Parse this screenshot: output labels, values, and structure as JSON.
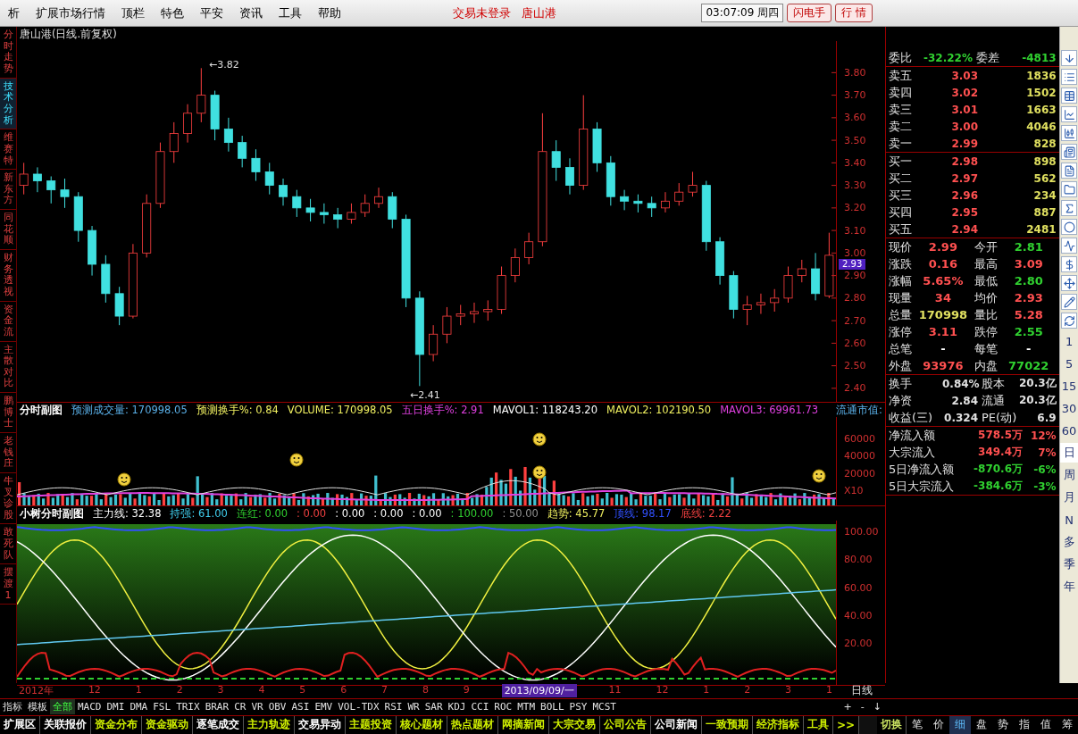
{
  "menu_bar": {
    "items": [
      "析",
      "扩展市场行情",
      "顶栏",
      "特色",
      "平安",
      "资讯",
      "工具",
      "帮助"
    ],
    "status": [
      "交易未登录",
      "唐山港"
    ],
    "clock": "03:07:09 周四",
    "buttons": [
      "闪电手",
      "行 情"
    ]
  },
  "side_tabs": [
    {
      "label": "分时走势",
      "selected": false
    },
    {
      "label": "技术分析",
      "selected": true
    },
    {
      "label": "维赛特",
      "selected": false
    },
    {
      "label": "新东方",
      "selected": false
    },
    {
      "label": "同花顺",
      "selected": false
    },
    {
      "label": "财务透视",
      "selected": false
    },
    {
      "label": "资金流",
      "selected": false
    },
    {
      "label": "主散对比",
      "selected": false
    },
    {
      "label": "鹏博士",
      "selected": false
    },
    {
      "label": "老钱庄",
      "selected": false
    },
    {
      "label": "牛叉诊股",
      "selected": false
    },
    {
      "label": "敢死队",
      "selected": false
    },
    {
      "label": "摆渡1",
      "selected": false
    }
  ],
  "price_chart": {
    "title": "唐山港(日线.前复权)",
    "high_label": "←3.82",
    "low_label": "←2.41",
    "last_price_tag": "2.93",
    "chart_data": {
      "type": "candlestick",
      "ylim": [
        2.34,
        3.94
      ],
      "yticks": [
        {
          "value": 3.8,
          "label": "3.80"
        },
        {
          "value": 3.7,
          "label": "3.70"
        },
        {
          "value": 3.6,
          "label": "3.60"
        },
        {
          "value": 3.5,
          "label": "3.50"
        },
        {
          "value": 3.4,
          "label": "3.40"
        },
        {
          "value": 3.3,
          "label": "3.30"
        },
        {
          "value": 3.2,
          "label": "3.20"
        },
        {
          "value": 3.1,
          "label": "3.10"
        },
        {
          "value": 3.0,
          "label": "3.00"
        },
        {
          "value": 2.9,
          "label": "2.90"
        },
        {
          "value": 2.8,
          "label": "2.80"
        },
        {
          "value": 2.7,
          "label": "2.70"
        },
        {
          "value": 2.6,
          "label": "2.60"
        },
        {
          "value": 2.5,
          "label": "2.50"
        },
        {
          "value": 2.4,
          "label": "2.40"
        }
      ],
      "ohlc": [
        [
          3.3,
          3.4,
          3.26,
          3.35
        ],
        [
          3.35,
          3.38,
          3.27,
          3.32
        ],
        [
          3.32,
          3.34,
          3.22,
          3.28
        ],
        [
          3.28,
          3.33,
          3.2,
          3.25
        ],
        [
          3.25,
          3.27,
          3.05,
          3.1
        ],
        [
          3.1,
          3.12,
          2.9,
          2.95
        ],
        [
          2.95,
          2.99,
          2.78,
          2.82
        ],
        [
          2.82,
          2.85,
          2.68,
          2.72
        ],
        [
          2.72,
          3.04,
          2.71,
          3.0
        ],
        [
          3.0,
          3.26,
          2.98,
          3.22
        ],
        [
          3.22,
          3.49,
          3.2,
          3.45
        ],
        [
          3.45,
          3.58,
          3.4,
          3.53
        ],
        [
          3.53,
          3.66,
          3.49,
          3.62
        ],
        [
          3.62,
          3.82,
          3.58,
          3.7
        ],
        [
          3.7,
          3.72,
          3.5,
          3.55
        ],
        [
          3.55,
          3.6,
          3.45,
          3.49
        ],
        [
          3.49,
          3.52,
          3.38,
          3.42
        ],
        [
          3.42,
          3.46,
          3.32,
          3.36
        ],
        [
          3.36,
          3.4,
          3.26,
          3.3
        ],
        [
          3.3,
          3.33,
          3.21,
          3.25
        ],
        [
          3.25,
          3.28,
          3.16,
          3.2
        ],
        [
          3.2,
          3.24,
          3.14,
          3.18
        ],
        [
          3.18,
          3.22,
          3.13,
          3.17
        ],
        [
          3.17,
          3.2,
          3.11,
          3.15
        ],
        [
          3.15,
          3.22,
          3.13,
          3.18
        ],
        [
          3.18,
          3.26,
          3.16,
          3.22
        ],
        [
          3.22,
          3.29,
          3.2,
          3.25
        ],
        [
          3.25,
          3.27,
          3.11,
          3.15
        ],
        [
          3.15,
          3.17,
          2.76,
          2.8
        ],
        [
          2.8,
          2.83,
          2.41,
          2.55
        ],
        [
          2.55,
          2.68,
          2.52,
          2.64
        ],
        [
          2.64,
          2.76,
          2.6,
          2.72
        ],
        [
          2.72,
          2.77,
          2.68,
          2.73
        ],
        [
          2.73,
          2.78,
          2.69,
          2.74
        ],
        [
          2.74,
          2.79,
          2.7,
          2.75
        ],
        [
          2.75,
          2.94,
          2.73,
          2.9
        ],
        [
          2.9,
          3.02,
          2.87,
          2.98
        ],
        [
          2.98,
          3.09,
          2.95,
          3.05
        ],
        [
          3.05,
          3.62,
          3.03,
          3.45
        ],
        [
          3.45,
          3.5,
          3.32,
          3.38
        ],
        [
          3.38,
          3.42,
          3.26,
          3.3
        ],
        [
          3.3,
          3.7,
          3.28,
          3.55
        ],
        [
          3.55,
          3.58,
          3.36,
          3.4
        ],
        [
          3.4,
          3.43,
          3.21,
          3.25
        ],
        [
          3.25,
          3.28,
          3.19,
          3.23
        ],
        [
          3.23,
          3.26,
          3.18,
          3.22
        ],
        [
          3.22,
          3.25,
          3.16,
          3.2
        ],
        [
          3.2,
          3.27,
          3.18,
          3.23
        ],
        [
          3.23,
          3.31,
          3.21,
          3.27
        ],
        [
          3.27,
          3.36,
          3.25,
          3.3
        ],
        [
          3.3,
          3.32,
          3.01,
          3.05
        ],
        [
          3.05,
          3.07,
          2.86,
          2.9
        ],
        [
          2.9,
          2.92,
          2.71,
          2.75
        ],
        [
          2.75,
          2.81,
          2.68,
          2.77
        ],
        [
          2.77,
          2.82,
          2.73,
          2.78
        ],
        [
          2.78,
          2.84,
          2.74,
          2.8
        ],
        [
          2.8,
          2.94,
          2.78,
          2.9
        ],
        [
          2.9,
          2.97,
          2.87,
          2.93
        ],
        [
          2.93,
          3.0,
          2.79,
          2.82
        ],
        [
          2.81,
          3.09,
          2.8,
          2.99
        ]
      ]
    }
  },
  "volume_chart": {
    "indicators": [
      {
        "text": "分时副图",
        "color": "#ffffff"
      },
      {
        "text": "预测成交量: 170998.05",
        "color": "#5ab0e8"
      },
      {
        "text": "预测换手%: 0.84",
        "color": "#f0f060"
      },
      {
        "text": "VOLUME: 170998.05",
        "color": "#f0f060"
      },
      {
        "text": "五日换手%: 2.91",
        "color": "#e040e0"
      },
      {
        "text": "MAVOL1: 118243.20",
        "color": "#ffffff"
      },
      {
        "text": "MAVOL2: 102190.50",
        "color": "#f0f060"
      },
      {
        "text": "MAVOL3: 69961.73",
        "color": "#e040e0"
      }
    ],
    "right_label": "流通市值:",
    "axis_labels": [
      "60000",
      "40000",
      "20000"
    ],
    "scale_label": "X10"
  },
  "indicator_chart": {
    "indicators": [
      {
        "text": "小树分时副图",
        "color": "#ffffff"
      },
      {
        "text": "主力线: 32.38",
        "color": "#ffffff"
      },
      {
        "text": "持强: 61.00",
        "color": "#40d0f0"
      },
      {
        "text": "连红: 0.00",
        "color": "#30d030"
      },
      {
        "text": ": 0.00",
        "color": "#f04040"
      },
      {
        "text": ": 0.00",
        "color": "#ffffff"
      },
      {
        "text": ": 0.00",
        "color": "#ffffff"
      },
      {
        "text": ": 0.00",
        "color": "#ffffff"
      },
      {
        "text": ": 100.00",
        "color": "#30d030"
      },
      {
        "text": ": 50.00",
        "color": "#909090"
      },
      {
        "text": "趋势: 45.77",
        "color": "#f0f060"
      },
      {
        "text": "顶线: 98.17",
        "color": "#3050ff"
      },
      {
        "text": "底线: 2.22",
        "color": "#f04040"
      }
    ],
    "axis_labels": [
      "100.00",
      "80.00",
      "60.00",
      "40.00",
      "20.00"
    ]
  },
  "date_axis": {
    "labels": [
      {
        "text": "2012年",
        "selected": false
      },
      {
        "text": "12",
        "selected": false
      },
      {
        "text": "1",
        "selected": false
      },
      {
        "text": "2",
        "selected": false
      },
      {
        "text": "3",
        "selected": false
      },
      {
        "text": "4",
        "selected": false
      },
      {
        "text": "5",
        "selected": false
      },
      {
        "text": "6",
        "selected": false
      },
      {
        "text": "7",
        "selected": false
      },
      {
        "text": "8",
        "selected": false
      },
      {
        "text": "9",
        "selected": false
      },
      {
        "text": "2013/09/09/一",
        "selected": true
      },
      {
        "text": "11",
        "selected": false
      },
      {
        "text": "12",
        "selected": false
      },
      {
        "text": "1",
        "selected": false
      },
      {
        "text": "2",
        "selected": false
      },
      {
        "text": "3",
        "selected": false
      },
      {
        "text": "1",
        "selected": false
      }
    ],
    "period": "日线"
  },
  "indicator_tabs": [
    {
      "label": "指标",
      "selected": false
    },
    {
      "label": "模板",
      "selected": false
    },
    {
      "label": "全部",
      "selected": true
    },
    {
      "label": "MACD",
      "selected": false
    },
    {
      "label": "DMI",
      "selected": false
    },
    {
      "label": "DMA",
      "selected": false
    },
    {
      "label": "FSL",
      "selected": false
    },
    {
      "label": "TRIX",
      "selected": false
    },
    {
      "label": "BRAR",
      "selected": false
    },
    {
      "label": "CR",
      "selected": false
    },
    {
      "label": "VR",
      "selected": false
    },
    {
      "label": "OBV",
      "selected": false
    },
    {
      "label": "ASI",
      "selected": false
    },
    {
      "label": "EMV",
      "selected": false
    },
    {
      "label": "VOL-TDX",
      "selected": false
    },
    {
      "label": "RSI",
      "selected": false
    },
    {
      "label": "WR",
      "selected": false
    },
    {
      "label": "SAR",
      "selected": false
    },
    {
      "label": "KDJ",
      "selected": false
    },
    {
      "label": "CCI",
      "selected": false
    },
    {
      "label": "ROC",
      "selected": false
    },
    {
      "label": "MTM",
      "selected": false
    },
    {
      "label": "BOLL",
      "selected": false
    },
    {
      "label": "PSY",
      "selected": false
    },
    {
      "label": "MCST",
      "selected": false
    }
  ],
  "indicator_buttons": [
    "+",
    "-",
    "↓"
  ],
  "bottom_tabs": [
    {
      "label": "扩展区",
      "color": "#ffffff"
    },
    {
      "label": "关联报价",
      "color": "#ffffff"
    },
    {
      "label": "资金分布",
      "color": "#d0f000"
    },
    {
      "label": "资金驱动",
      "color": "#d0f000"
    },
    {
      "label": "逐笔成交",
      "color": "#ffffff"
    },
    {
      "label": "主力轨迹",
      "color": "#d0f000"
    },
    {
      "label": "交易异动",
      "color": "#ffffff"
    },
    {
      "label": "主题投资",
      "color": "#d0f000"
    },
    {
      "label": "核心题材",
      "color": "#d0f000"
    },
    {
      "label": "热点题材",
      "color": "#d0f000"
    },
    {
      "label": "网摘新闻",
      "color": "#d0f000"
    },
    {
      "label": "大宗交易",
      "color": "#d0f000"
    },
    {
      "label": "公司公告",
      "color": "#d0f000"
    },
    {
      "label": "公司新闻",
      "color": "#ffffff"
    },
    {
      "label": "一致预期",
      "color": "#d0f000"
    },
    {
      "label": "经济指标",
      "color": "#d0f000"
    },
    {
      "label": "工具",
      "color": "#d0f000"
    },
    {
      "label": ">>",
      "color": "#d0f000"
    }
  ],
  "switch_label": "切换",
  "view_tabs": [
    {
      "label": "笔",
      "selected": false
    },
    {
      "label": "价",
      "selected": false
    },
    {
      "label": "细",
      "selected": true
    },
    {
      "label": "盘",
      "selected": false
    },
    {
      "label": "势",
      "selected": false
    },
    {
      "label": "指",
      "selected": false
    },
    {
      "label": "值",
      "selected": false
    },
    {
      "label": "筹",
      "selected": false
    }
  ],
  "quote_panel": {
    "ratio": {
      "label": "委比",
      "value": "-32.22%",
      "label2": "委差",
      "value2": "-4813"
    },
    "asks": [
      {
        "label": "卖五",
        "price": "3.03",
        "volume": "1836"
      },
      {
        "label": "卖四",
        "price": "3.02",
        "volume": "1502"
      },
      {
        "label": "卖三",
        "price": "3.01",
        "volume": "1663"
      },
      {
        "label": "卖二",
        "price": "3.00",
        "volume": "4046"
      },
      {
        "label": "卖一",
        "price": "2.99",
        "volume": "828"
      }
    ],
    "bids": [
      {
        "label": "买一",
        "price": "2.98",
        "volume": "898"
      },
      {
        "label": "买二",
        "price": "2.97",
        "volume": "562"
      },
      {
        "label": "买三",
        "price": "2.96",
        "volume": "234"
      },
      {
        "label": "买四",
        "price": "2.95",
        "volume": "887"
      },
      {
        "label": "买五",
        "price": "2.94",
        "volume": "2481"
      }
    ],
    "stats": [
      {
        "label": "现价",
        "value": "2.99",
        "color": "#ff5050"
      },
      {
        "label": "今开",
        "value": "2.81",
        "color": "#30d030"
      },
      {
        "label": "涨跌",
        "value": "0.16",
        "color": "#ff5050"
      },
      {
        "label": "最高",
        "value": "3.09",
        "color": "#ff5050"
      },
      {
        "label": "涨幅",
        "value": "5.65%",
        "color": "#ff5050"
      },
      {
        "label": "最低",
        "value": "2.80",
        "color": "#30d030"
      },
      {
        "label": "现量",
        "value": "34",
        "color": "#ff5050"
      },
      {
        "label": "均价",
        "value": "2.93",
        "color": "#ff5050"
      },
      {
        "label": "总量",
        "value": "170998",
        "color": "#e0e060"
      },
      {
        "label": "量比",
        "value": "5.28",
        "color": "#ff5050"
      },
      {
        "label": "涨停",
        "value": "3.11",
        "color": "#ff5050"
      },
      {
        "label": "跌停",
        "value": "2.55",
        "color": "#30d030"
      },
      {
        "label": "总笔",
        "value": "-",
        "color": "#ffffff"
      },
      {
        "label": "每笔",
        "value": "-",
        "color": "#ffffff"
      },
      {
        "label": "外盘",
        "value": "93976",
        "color": "#ff5050"
      },
      {
        "label": "内盘",
        "value": "77022",
        "color": "#30d030"
      }
    ],
    "fundamentals": [
      {
        "label": "换手",
        "value": "0.84%",
        "label2": "股本",
        "value2": "20.3亿"
      },
      {
        "label": "净资",
        "value": "2.84",
        "label2": "流通",
        "value2": "20.3亿"
      },
      {
        "label": "收益(三)",
        "value": "0.324",
        "label2": "PE(动)",
        "value2": "6.9"
      }
    ],
    "flows": [
      {
        "label": "净流入额",
        "amount": "578.5万",
        "pct": "12%",
        "color": "#ff5050"
      },
      {
        "label": "大宗流入",
        "amount": "349.4万",
        "pct": "7%",
        "color": "#ff5050"
      },
      {
        "label": "5日净流入额",
        "amount": "-870.6万",
        "pct": "-6%",
        "color": "#30d030"
      },
      {
        "label": "5日大宗流入",
        "amount": "-384.6万",
        "pct": "-3%",
        "color": "#30d030"
      }
    ]
  },
  "toolbar": {
    "periods": [
      {
        "label": "1",
        "selected": false
      },
      {
        "label": "5",
        "selected": false
      },
      {
        "label": "15",
        "selected": false
      },
      {
        "label": "30",
        "selected": false
      },
      {
        "label": "60",
        "selected": false
      },
      {
        "label": "日",
        "selected": true
      },
      {
        "label": "周",
        "selected": false
      },
      {
        "label": "月",
        "selected": false
      },
      {
        "label": "N",
        "selected": false
      },
      {
        "label": "多",
        "selected": false
      },
      {
        "label": "季",
        "selected": false
      },
      {
        "label": "年",
        "selected": false
      }
    ]
  }
}
